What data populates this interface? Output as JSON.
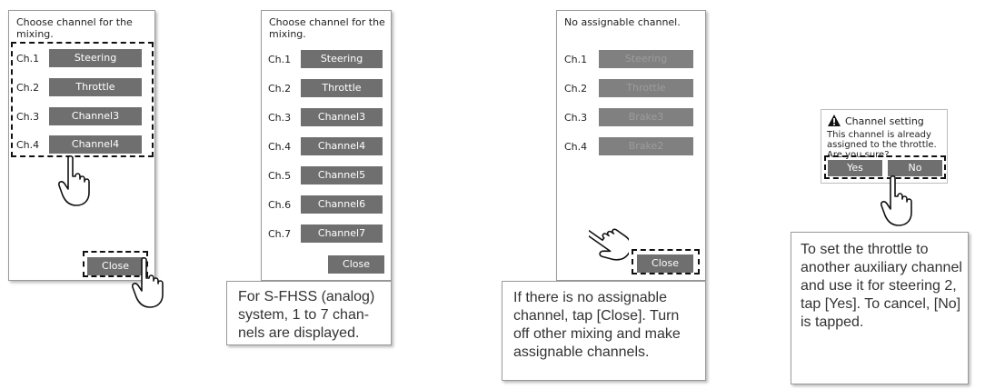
{
  "panel1": {
    "prompt": "Choose channel for the mixing.",
    "channels": [
      {
        "label": "Ch.1",
        "button": "Steering"
      },
      {
        "label": "Ch.2",
        "button": "Throttle"
      },
      {
        "label": "Ch.3",
        "button": "Channel3"
      },
      {
        "label": "Ch.4",
        "button": "Channel4"
      }
    ],
    "close_label": "Close"
  },
  "panel2": {
    "prompt": "Choose channel for the mixing.",
    "channels": [
      {
        "label": "Ch.1",
        "button": "Steering"
      },
      {
        "label": "Ch.2",
        "button": "Throttle"
      },
      {
        "label": "Ch.3",
        "button": "Channel3"
      },
      {
        "label": "Ch.4",
        "button": "Channel4"
      },
      {
        "label": "Ch.5",
        "button": "Channel5"
      },
      {
        "label": "Ch.6",
        "button": "Channel6"
      },
      {
        "label": "Ch.7",
        "button": "Channel7"
      }
    ],
    "close_label": "Close",
    "caption": "For S-FHSS (analog) system, 1 to 7 chan-nels are displayed."
  },
  "panel3": {
    "prompt": "No assignable channel.",
    "channels": [
      {
        "label": "Ch.1",
        "button": "Steering"
      },
      {
        "label": "Ch.2",
        "button": "Throttle"
      },
      {
        "label": "Ch.3",
        "button": "Brake3"
      },
      {
        "label": "Ch.4",
        "button": "Brake2"
      }
    ],
    "close_label": "Close",
    "caption": "If there is no assignable channel, tap [Close]. Turn off other mixing and make assignable  channels."
  },
  "dialog": {
    "title": "Channel setting",
    "message": "This channel is already assigned to the throttle. Are you sure?",
    "yes_label": "Yes",
    "no_label": "No",
    "caption": "To set the throttle to another auxiliary channel and use it for steering 2, tap [Yes]. To cancel, [No] is tapped."
  },
  "icons": {
    "hand": "pointing-hand-icon",
    "warning": "warning-triangle-icon"
  },
  "colors": {
    "button": "#6f6f6f",
    "button_dim_text": "#9c9c9c",
    "dashed_outline": "#111111"
  }
}
